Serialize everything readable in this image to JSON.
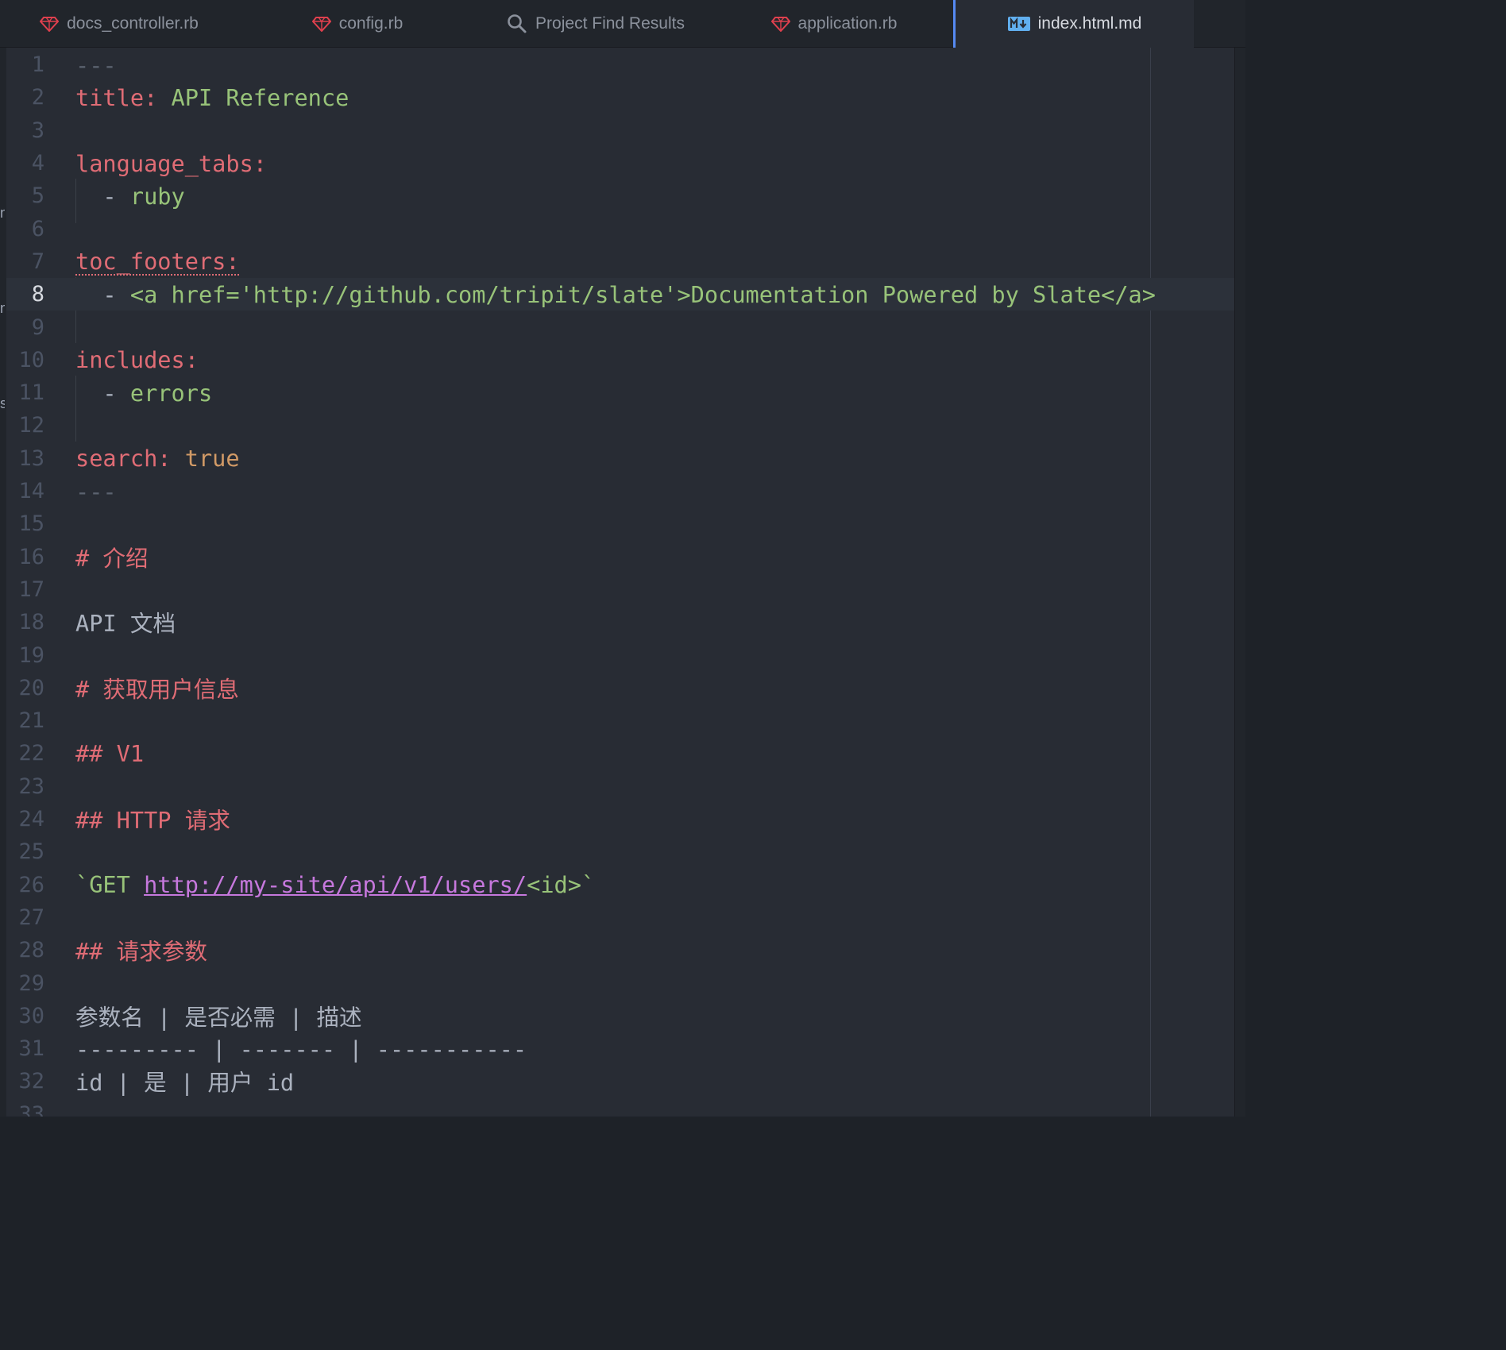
{
  "tabs": [
    {
      "label": "docs_controller.rb",
      "icon": "ruby-gem-icon",
      "active": false
    },
    {
      "label": "config.rb",
      "icon": "ruby-gem-icon",
      "active": false
    },
    {
      "label": "Project Find Results",
      "icon": "search-icon",
      "active": false
    },
    {
      "label": "application.rb",
      "icon": "ruby-gem-icon",
      "active": false
    },
    {
      "label": "index.html.md",
      "icon": "markdown-icon",
      "active": true
    }
  ],
  "colors": {
    "accent": "#568af2",
    "ruby_icon": "#e0404e",
    "markdown_icon": "#61afef"
  },
  "editor": {
    "current_line": 8,
    "lines": [
      {
        "n": "1",
        "segments": [
          {
            "t": "---",
            "c": "tok-dash"
          }
        ]
      },
      {
        "n": "2",
        "segments": [
          {
            "t": "title: ",
            "c": "tok-key"
          },
          {
            "t": "API Reference",
            "c": "tok-str"
          }
        ]
      },
      {
        "n": "3",
        "segments": []
      },
      {
        "n": "4",
        "segments": [
          {
            "t": "language_tabs:",
            "c": "tok-key"
          }
        ]
      },
      {
        "n": "5",
        "segments": [
          {
            "t": "  - ",
            "c": "tok-text"
          },
          {
            "t": "ruby",
            "c": "tok-str"
          }
        ]
      },
      {
        "n": "6",
        "segments": []
      },
      {
        "n": "7",
        "segments": [
          {
            "t": "toc_footers:",
            "c": "tok-key tok-err"
          }
        ]
      },
      {
        "n": "8",
        "segments": [
          {
            "t": "  - ",
            "c": "tok-text"
          },
          {
            "t": "<a href='http://github.com/tripit/slate'>Documentation Powered by Slate</a>",
            "c": "tok-str"
          }
        ]
      },
      {
        "n": "9",
        "segments": []
      },
      {
        "n": "10",
        "segments": [
          {
            "t": "includes:",
            "c": "tok-key"
          }
        ]
      },
      {
        "n": "11",
        "segments": [
          {
            "t": "  - ",
            "c": "tok-text"
          },
          {
            "t": "errors",
            "c": "tok-str"
          }
        ]
      },
      {
        "n": "12",
        "segments": []
      },
      {
        "n": "13",
        "segments": [
          {
            "t": "search: ",
            "c": "tok-key"
          },
          {
            "t": "true",
            "c": "tok-bool"
          }
        ]
      },
      {
        "n": "14",
        "segments": [
          {
            "t": "---",
            "c": "tok-dash"
          }
        ]
      },
      {
        "n": "15",
        "segments": []
      },
      {
        "n": "16",
        "segments": [
          {
            "t": "# 介绍",
            "c": "tok-head"
          }
        ]
      },
      {
        "n": "17",
        "segments": []
      },
      {
        "n": "18",
        "segments": [
          {
            "t": "API 文档",
            "c": "tok-text"
          }
        ]
      },
      {
        "n": "19",
        "segments": []
      },
      {
        "n": "20",
        "segments": [
          {
            "t": "# 获取用户信息",
            "c": "tok-head"
          }
        ]
      },
      {
        "n": "21",
        "segments": []
      },
      {
        "n": "22",
        "segments": [
          {
            "t": "## V1",
            "c": "tok-head"
          }
        ]
      },
      {
        "n": "23",
        "segments": []
      },
      {
        "n": "24",
        "segments": [
          {
            "t": "## HTTP 请求",
            "c": "tok-head"
          }
        ]
      },
      {
        "n": "25",
        "segments": []
      },
      {
        "n": "26",
        "segments": [
          {
            "t": "`GET ",
            "c": "tok-str"
          },
          {
            "t": "http://my-site/api/v1/users/",
            "c": "tok-link"
          },
          {
            "t": "<id>`",
            "c": "tok-str"
          }
        ]
      },
      {
        "n": "27",
        "segments": []
      },
      {
        "n": "28",
        "segments": [
          {
            "t": "## 请求参数",
            "c": "tok-head"
          }
        ]
      },
      {
        "n": "29",
        "segments": []
      },
      {
        "n": "30",
        "segments": [
          {
            "t": "参数名 | 是否必需 | 描述",
            "c": "tok-text"
          }
        ]
      },
      {
        "n": "31",
        "segments": [
          {
            "t": "--------- | ------- | -----------",
            "c": "tok-text"
          }
        ]
      },
      {
        "n": "32",
        "segments": [
          {
            "t": "id | 是 | 用户 id",
            "c": "tok-text"
          }
        ]
      },
      {
        "n": "33",
        "segments": []
      }
    ]
  }
}
